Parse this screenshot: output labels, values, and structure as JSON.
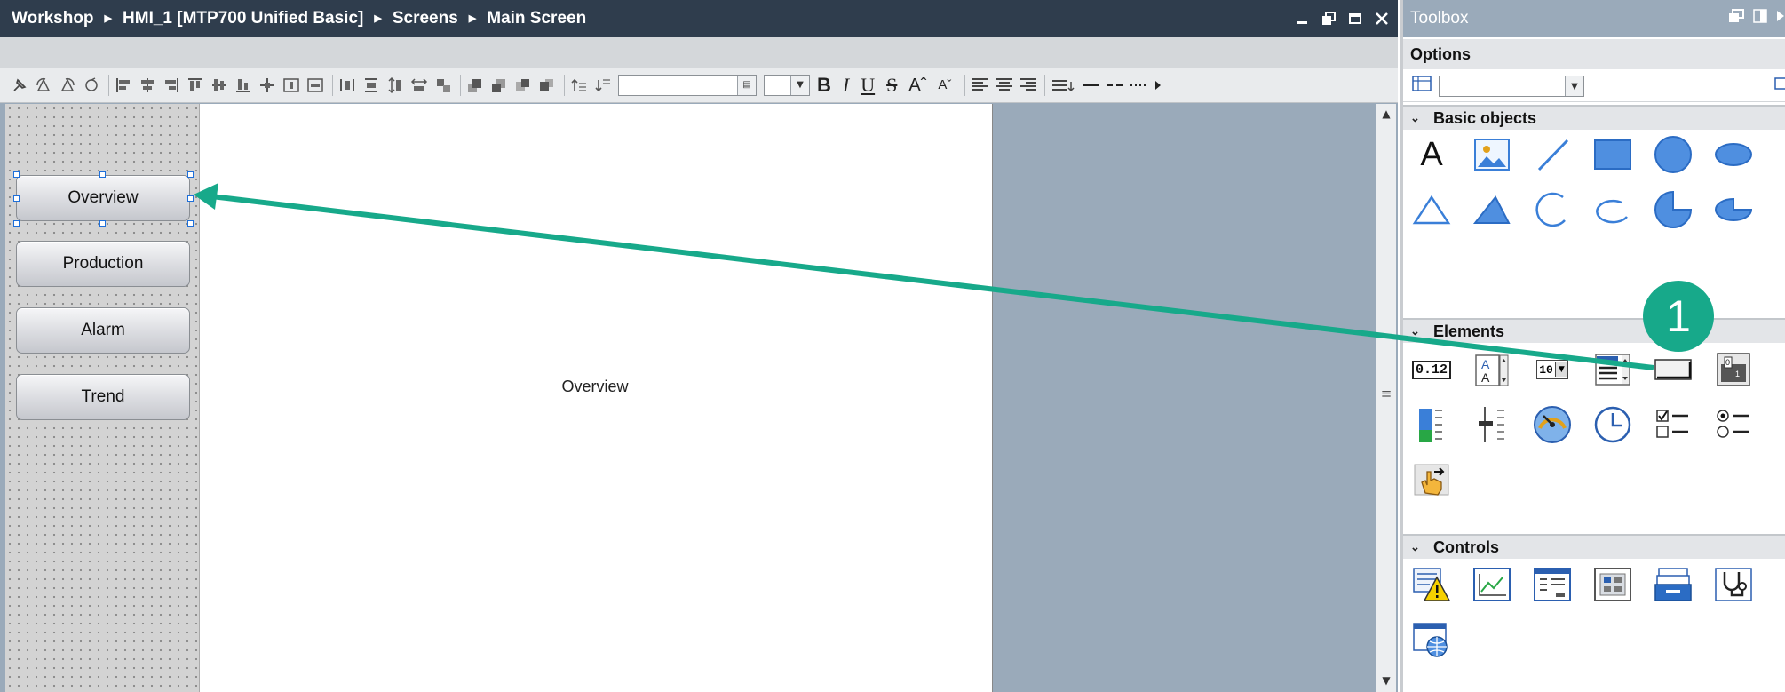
{
  "titlebar": {
    "breadcrumb": [
      "Workshop",
      "HMI_1 [MTP700 Unified Basic]",
      "Screens",
      "Main Screen"
    ]
  },
  "toolbar": {
    "bold": "B",
    "italic": "I",
    "underline": "U",
    "strike": "S",
    "grow_font": "Aˆ",
    "shrink_font": "Aˇ"
  },
  "screen": {
    "nav_buttons": [
      "Overview",
      "Production",
      "Alarm",
      "Trend"
    ],
    "canvas_label": "Overview"
  },
  "toolbox": {
    "title": "Toolbox",
    "options_label": "Options",
    "sections": {
      "basic_objects": "Basic objects",
      "elements": "Elements",
      "controls": "Controls"
    },
    "basic_object_text_tool": "A",
    "io_field_value": "0.12",
    "symbolic_io_value": "10"
  },
  "annotation": {
    "marker_label": "1",
    "color": "#17a98a"
  },
  "colors": {
    "titlebar": "#2f3d4d",
    "workspace": "#9aaaba",
    "selection_handle": "#1e6fd9",
    "accent_blue": "#3a7fd8"
  }
}
